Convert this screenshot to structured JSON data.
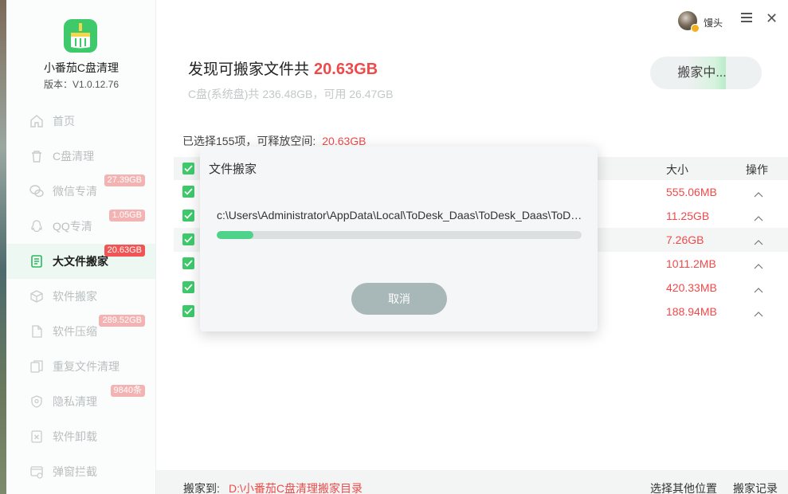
{
  "app": {
    "name": "小番茄C盘清理",
    "version": "版本：V1.0.12.76"
  },
  "user": {
    "name": "馒头"
  },
  "sidebar": {
    "items": [
      {
        "label": "首页",
        "icon": "home-icon",
        "badge": ""
      },
      {
        "label": "C盘清理",
        "icon": "trash-icon",
        "badge": ""
      },
      {
        "label": "微信专清",
        "icon": "wechat-icon",
        "badge": "27.39GB"
      },
      {
        "label": "QQ专清",
        "icon": "qq-icon",
        "badge": "1.05GB"
      },
      {
        "label": "大文件搬家",
        "icon": "file-move-icon",
        "badge": "20.63GB",
        "active": true
      },
      {
        "label": "软件搬家",
        "icon": "box-icon",
        "badge": ""
      },
      {
        "label": "软件压缩",
        "icon": "compress-icon",
        "badge": "289.52GB"
      },
      {
        "label": "重复文件清理",
        "icon": "duplicate-icon",
        "badge": ""
      },
      {
        "label": "隐私清理",
        "icon": "shield-icon",
        "badge": "9840条"
      },
      {
        "label": "软件卸载",
        "icon": "uninstall-icon",
        "badge": ""
      },
      {
        "label": "弹窗拦截",
        "icon": "popup-block-icon",
        "badge": ""
      }
    ]
  },
  "main": {
    "headline": "发现可搬家文件共",
    "headline_size": "20.63GB",
    "disk_info": "C盘(系统盘)共 236.48GB，可用 26.47GB",
    "move_button": "搬家中...",
    "selected_text": "已选择155项，可释放空间:",
    "selected_amount": "20.63GB",
    "columns": {
      "size": "大小",
      "op": "操作"
    },
    "rows": [
      {
        "size": "555.06MB"
      },
      {
        "size": "11.25GB"
      },
      {
        "size": "7.26GB"
      },
      {
        "size": "1011.2MB"
      },
      {
        "size": "420.33MB"
      },
      {
        "size": "188.94MB"
      }
    ]
  },
  "footer": {
    "label": "搬家到:",
    "path": "D:\\小番茄C盘清理搬家目录",
    "choose_other": "选择其他位置",
    "record": "搬家记录"
  },
  "modal": {
    "title": "文件搬家",
    "path": "c:\\Users\\Administrator\\AppData\\Local\\ToDesk_Daas\\ToDesk_Daas\\ToDesk_Daas.exe",
    "progress": 0.1,
    "cancel": "取消"
  },
  "colors": {
    "accent_green": "#3ec96b",
    "alert_red": "#ee4a4a"
  }
}
